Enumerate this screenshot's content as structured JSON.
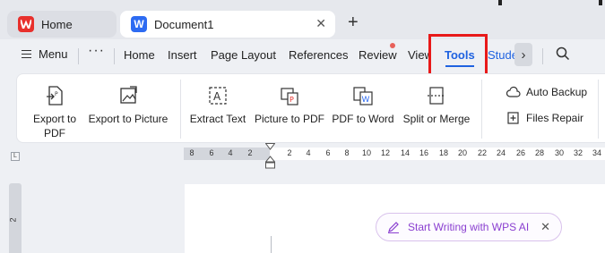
{
  "tabs": {
    "home_label": "Home",
    "home_logo": "W",
    "doc_label": "Document1",
    "doc_logo": "W",
    "close": "✕",
    "new_tab": "+"
  },
  "menu": {
    "menu_label": "Menu",
    "more": "···",
    "items": [
      "Home",
      "Insert",
      "Page Layout",
      "References",
      "Review",
      "View"
    ],
    "active": "Tools",
    "next_partial": "Stude",
    "scroll_arrow": "›",
    "review_badge_color": "#e8615a",
    "accent_color": "#1f62e0",
    "highlight_color": "#e81919"
  },
  "ribbon": {
    "export_pdf": [
      "Export to",
      "PDF"
    ],
    "export_picture": "Export to Picture",
    "extract_text": "Extract Text",
    "picture_to_pdf": "Picture to PDF",
    "pdf_to_word": "PDF to Word",
    "split_merge": "Split or Merge",
    "auto_backup": "Auto Backup",
    "files_repair": "Files Repair"
  },
  "ruler": {
    "corner": "L",
    "left_ticks": [
      "8",
      "6",
      "4",
      "2"
    ],
    "right_ticks": [
      "2",
      "4",
      "6",
      "8",
      "10",
      "12",
      "14",
      "16",
      "18",
      "20",
      "22",
      "24",
      "26",
      "28",
      "30",
      "32",
      "34"
    ],
    "vertical_tick": "2"
  },
  "ai_prompt": {
    "text": "Start Writing with WPS AI",
    "close": "✕",
    "color": "#8a3fd0"
  }
}
